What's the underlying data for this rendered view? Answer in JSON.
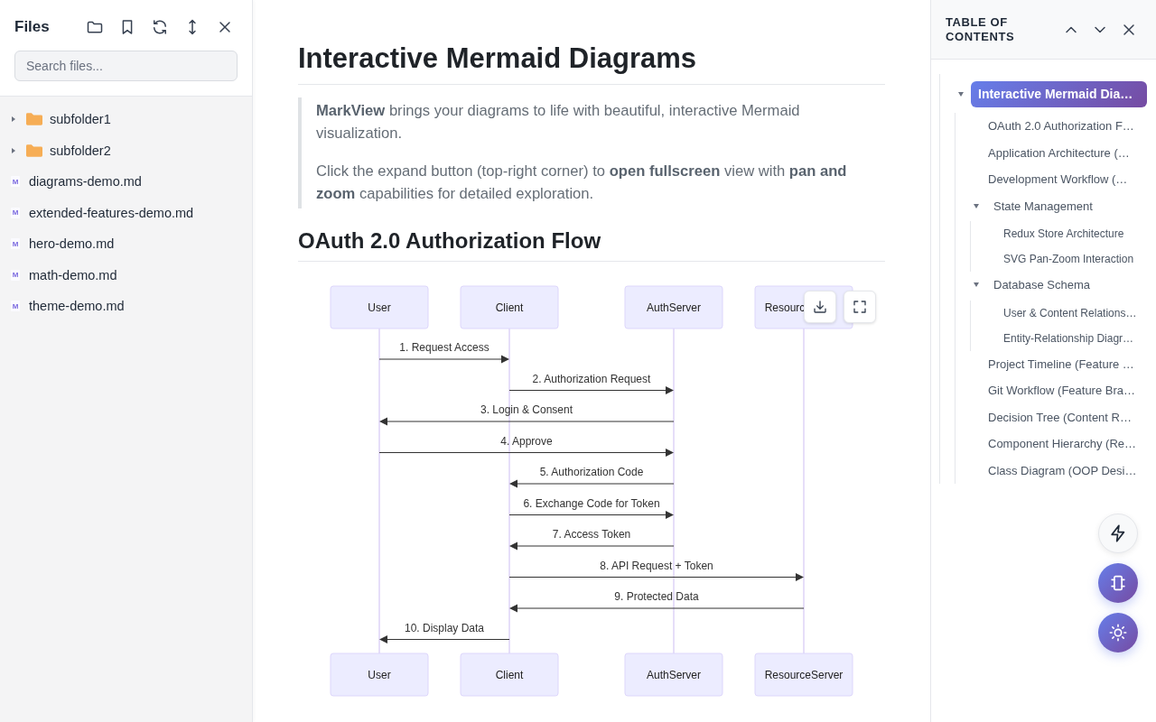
{
  "file_sidebar": {
    "title": "Files",
    "search": {
      "placeholder": "Search files..."
    },
    "items": [
      {
        "kind": "folder",
        "name": "subfolder1",
        "expanded": false
      },
      {
        "kind": "folder",
        "name": "subfolder2",
        "expanded": false
      },
      {
        "kind": "file",
        "glyph": "M",
        "name": "diagrams-demo.md"
      },
      {
        "kind": "file",
        "glyph": "M",
        "name": "extended-features-demo.md"
      },
      {
        "kind": "file",
        "glyph": "M",
        "name": "hero-demo.md"
      },
      {
        "kind": "file",
        "glyph": "M",
        "name": "math-demo.md"
      },
      {
        "kind": "file",
        "glyph": "M",
        "name": "theme-demo.md"
      }
    ]
  },
  "document": {
    "title": "Interactive Mermaid Diagrams",
    "callout": [
      "**MarkView** brings your diagrams to life with beautiful, interactive Mermaid visualization.",
      "Click the expand button (top-right corner) to **open fullscreen** view with **pan and zoom** capabilities for detailed exploration."
    ],
    "section_title": "OAuth 2.0 Authorization Flow",
    "sequence_diagram": {
      "participants": [
        {
          "top_label": "User",
          "bottom_label": "User"
        },
        {
          "top_label": "Client",
          "bottom_label": "Client"
        },
        {
          "top_label": "AuthServer",
          "bottom_label": "AuthServer"
        },
        {
          "top_label": "Resourc",
          "bottom_label": "ResourceServer"
        }
      ],
      "messages": [
        {
          "label": "1. Request Access",
          "kind": "user-to-client"
        },
        {
          "label": "2. Authorization Request",
          "kind": "client-to-auth"
        },
        {
          "label": "3. Login & Consent",
          "kind": "auth-to-user"
        },
        {
          "label": "4. Approve",
          "kind": "user-to-auth"
        },
        {
          "label": "5. Authorization Code",
          "kind": "auth-to-client"
        },
        {
          "label": "6. Exchange Code for Token",
          "kind": "client-to-auth"
        },
        {
          "label": "7. Access Token",
          "kind": "auth-to-client"
        },
        {
          "label": "8. API Request + Token",
          "kind": "client-to-resource"
        },
        {
          "label": "9. Protected Data",
          "kind": "resource-to-client"
        },
        {
          "label": "10. Display Data",
          "kind": "client-to-user"
        }
      ]
    }
  },
  "toc": {
    "title": "TABLE OF CONTENTS",
    "items": [
      {
        "label": "Interactive Mermaid Dia…",
        "selected": true,
        "expanded": true,
        "children": [
          {
            "label": "OAuth 2.0 Authorization F…",
            "selected": false
          },
          {
            "label": "Application Architecture (…",
            "selected": false
          },
          {
            "label": "Development Workflow (…",
            "selected": false
          },
          {
            "label": "State Management",
            "selected": false,
            "expanded": true,
            "children": [
              {
                "label": "Redux Store Architecture",
                "selected": false
              },
              {
                "label": "SVG Pan-Zoom Interaction",
                "selected": false
              }
            ]
          },
          {
            "label": "Database Schema",
            "selected": false,
            "expanded": true,
            "children": [
              {
                "label": "User & Content Relations…",
                "selected": false
              },
              {
                "label": "Entity-Relationship Diagr…",
                "selected": false
              }
            ]
          },
          {
            "label": "Project Timeline (Feature …",
            "selected": false
          },
          {
            "label": "Git Workflow (Feature Bra…",
            "selected": false
          },
          {
            "label": "Decision Tree (Content R…",
            "selected": false
          },
          {
            "label": "Component Hierarchy (Re…",
            "selected": false
          },
          {
            "label": "Class Diagram (OOP Desi…",
            "selected": false
          }
        ]
      }
    ]
  }
}
